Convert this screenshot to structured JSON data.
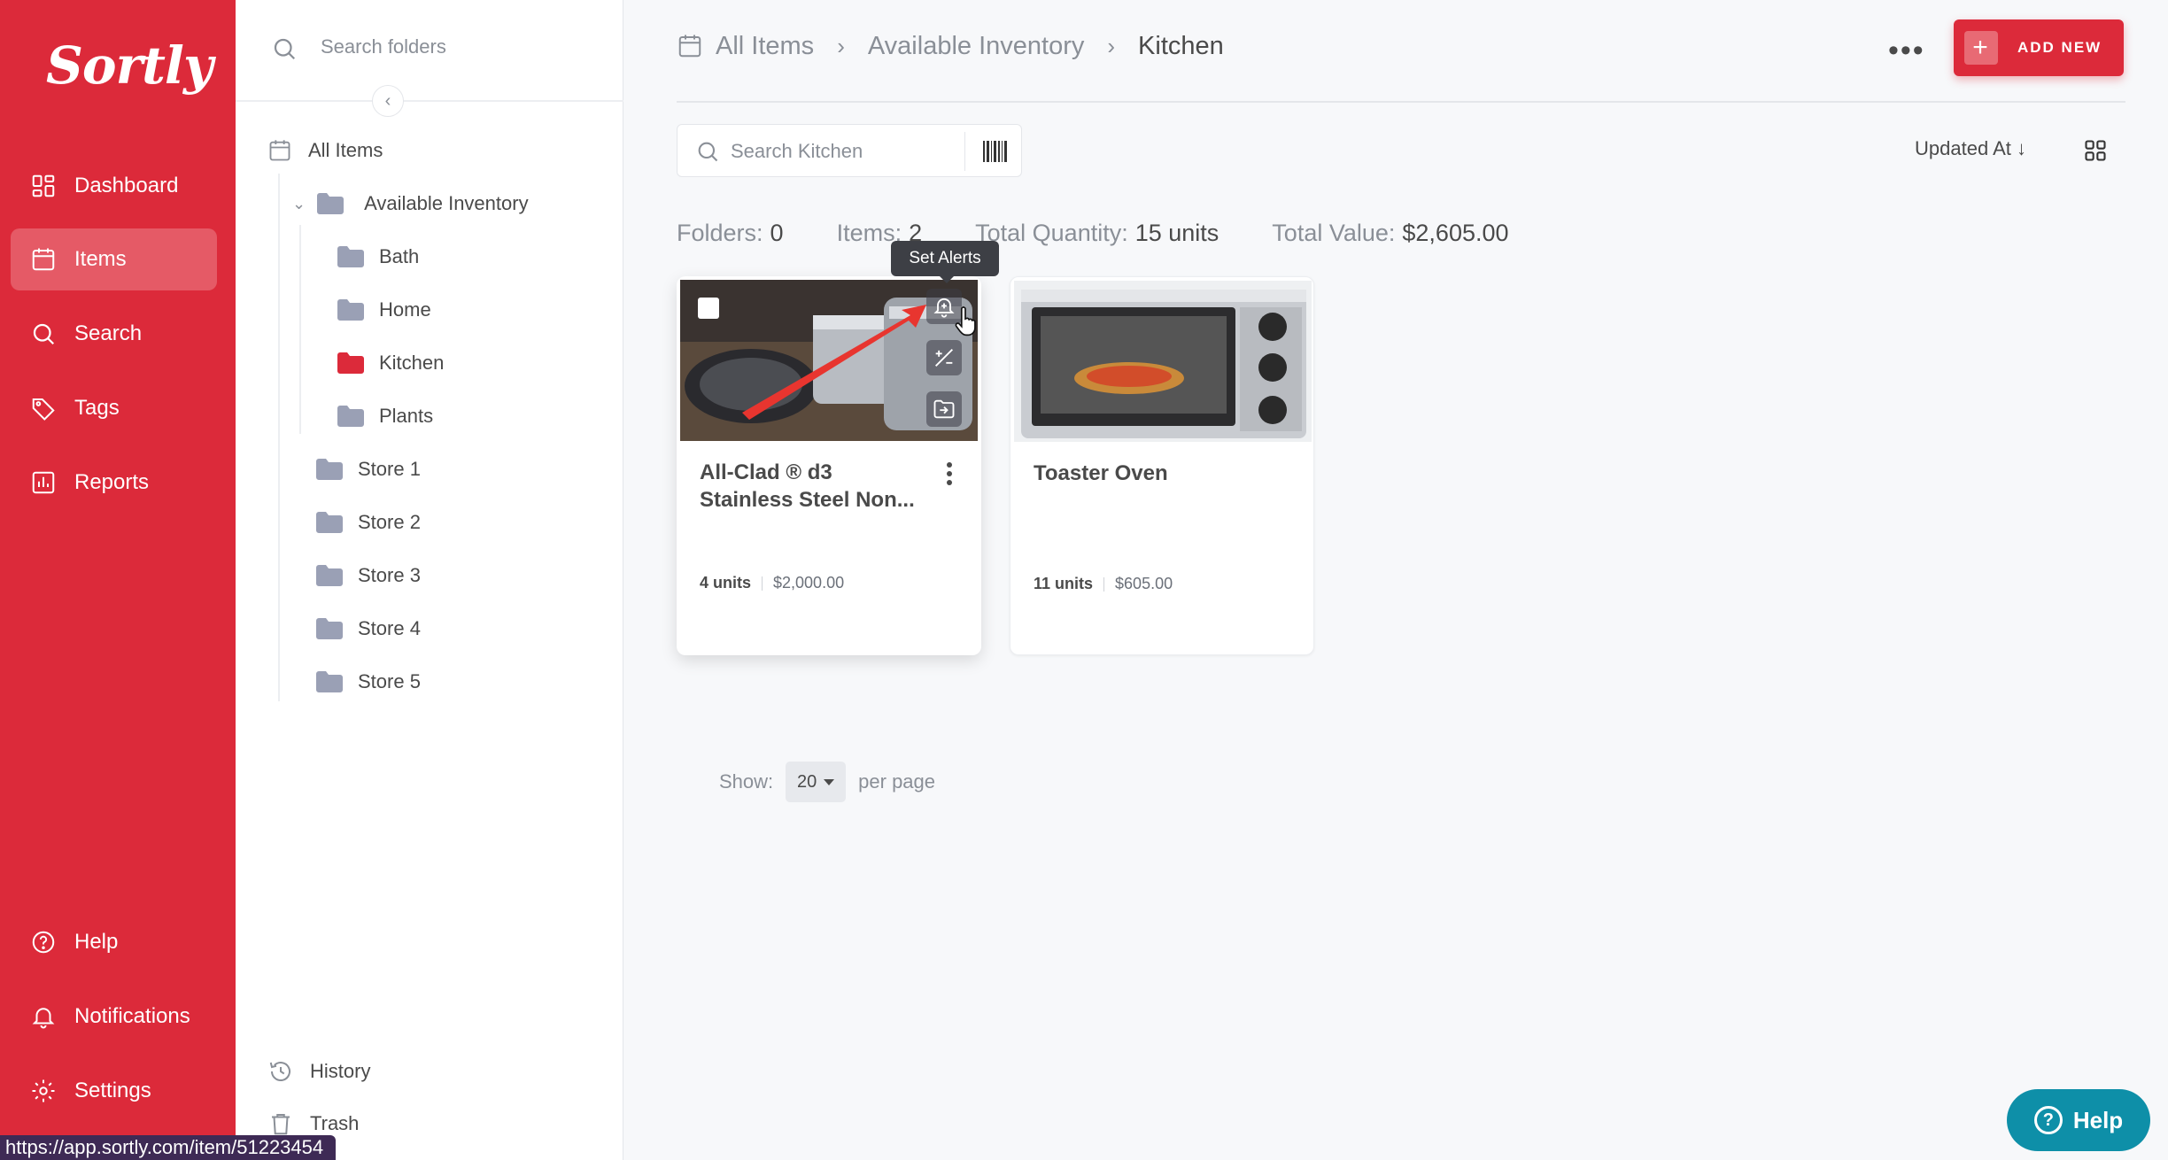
{
  "nav": {
    "logo": "Sortly",
    "items": [
      {
        "label": "Dashboard",
        "icon": "dashboard-icon"
      },
      {
        "label": "Items",
        "icon": "items-icon",
        "active": true
      },
      {
        "label": "Search",
        "icon": "search-icon"
      },
      {
        "label": "Tags",
        "icon": "tags-icon"
      },
      {
        "label": "Reports",
        "icon": "reports-icon"
      }
    ],
    "bottom": [
      {
        "label": "Help",
        "icon": "help-icon"
      },
      {
        "label": "Notifications",
        "icon": "bell-icon"
      },
      {
        "label": "Settings",
        "icon": "gear-icon"
      }
    ]
  },
  "tree": {
    "search_placeholder": "Search folders",
    "all_items": "All Items",
    "available": "Available Inventory",
    "sub": [
      "Bath",
      "Home",
      "Kitchen",
      "Plants"
    ],
    "stores": [
      "Store 1",
      "Store 2",
      "Store 3",
      "Store 4",
      "Store 5"
    ],
    "history": "History",
    "trash": "Trash"
  },
  "breadcrumb": [
    "All Items",
    "Available Inventory",
    "Kitchen"
  ],
  "header": {
    "add_new": "ADD NEW"
  },
  "search": {
    "placeholder": "Search Kitchen"
  },
  "sort": {
    "label": "Updated At"
  },
  "stats": {
    "folders_label": "Folders:",
    "folders": "0",
    "items_label": "Items:",
    "items": "2",
    "qty_label": "Total Quantity:",
    "qty": "15 units",
    "value_label": "Total Value:",
    "value": "$2,605.00"
  },
  "items": [
    {
      "title": "All-Clad ® d3 Stainless Steel Non...",
      "units": "4 units",
      "price": "$2,000.00"
    },
    {
      "title": "Toaster Oven",
      "units": "11 units",
      "price": "$605.00"
    }
  ],
  "tooltip": "Set Alerts",
  "pager": {
    "show": "Show:",
    "per_page_value": "20",
    "per_page": "per page"
  },
  "help_button": "Help",
  "status_url": "https://app.sortly.com/item/51223454",
  "colors": {
    "brand": "#dc2a3a",
    "help": "#0e8fa8"
  }
}
